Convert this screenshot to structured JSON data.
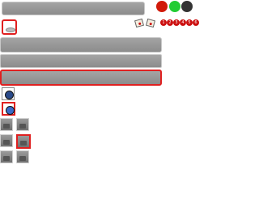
{
  "window": {
    "title_bar_color": "#8c8c8c",
    "close_color": "#d11a0a",
    "maximize_color": "#22cc33",
    "minimize_color": "#333333"
  },
  "toolbar": {
    "selected_tool_icon": "oval-icon",
    "tool_icons": [
      "note-icon",
      "note-icon"
    ],
    "numbered_markers": [
      "1",
      "2",
      "3",
      "4",
      "5",
      "6"
    ]
  },
  "bars": [
    {
      "name": "bar-1",
      "state": "normal"
    },
    {
      "name": "bar-2",
      "state": "normal"
    },
    {
      "name": "bar-3",
      "state": "selected"
    }
  ],
  "round_icons": [
    "globe-icon",
    "globe-icon-selected"
  ],
  "tile_grid": {
    "icon": "unlock-icon",
    "rows": 3,
    "cols": 2,
    "selected": [
      1,
      1
    ]
  },
  "accent_color": "#e02020"
}
